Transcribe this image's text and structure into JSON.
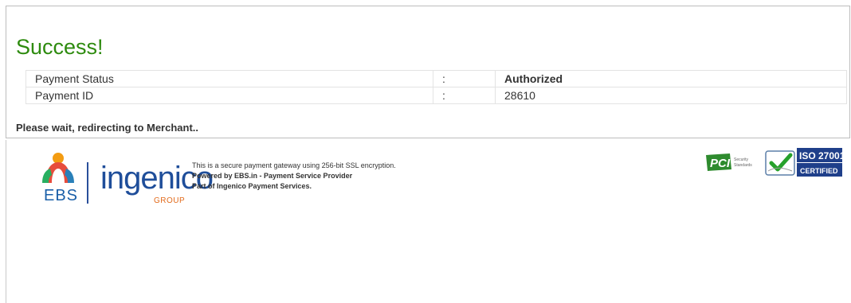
{
  "result": {
    "title": "Success!",
    "rows": [
      {
        "label": "Payment Status",
        "separator": ":",
        "value": "Authorized"
      },
      {
        "label": "Payment ID",
        "separator": ":",
        "value": "28610"
      }
    ],
    "redirect_message": "Please wait, redirecting to Merchant.."
  },
  "footer": {
    "ebs_logo_text": "EBS",
    "ingenico_logo_text": "ingenico",
    "ingenico_group_text": "GROUP",
    "line1": "This is a secure payment gateway using 256-bit SSL encryption.",
    "line2": "Powered by EBS.in - Payment Service Provider",
    "line3": "Part of Ingenico Payment Services.",
    "pci_text": "PCI",
    "pci_sub": "Security Standards",
    "iso_line1": "ISO 27001",
    "iso_line2": "CERTIFIED"
  },
  "colors": {
    "success_green": "#2e8b0f",
    "ingenico_blue": "#1f4e9a",
    "group_orange": "#e26b1c"
  }
}
